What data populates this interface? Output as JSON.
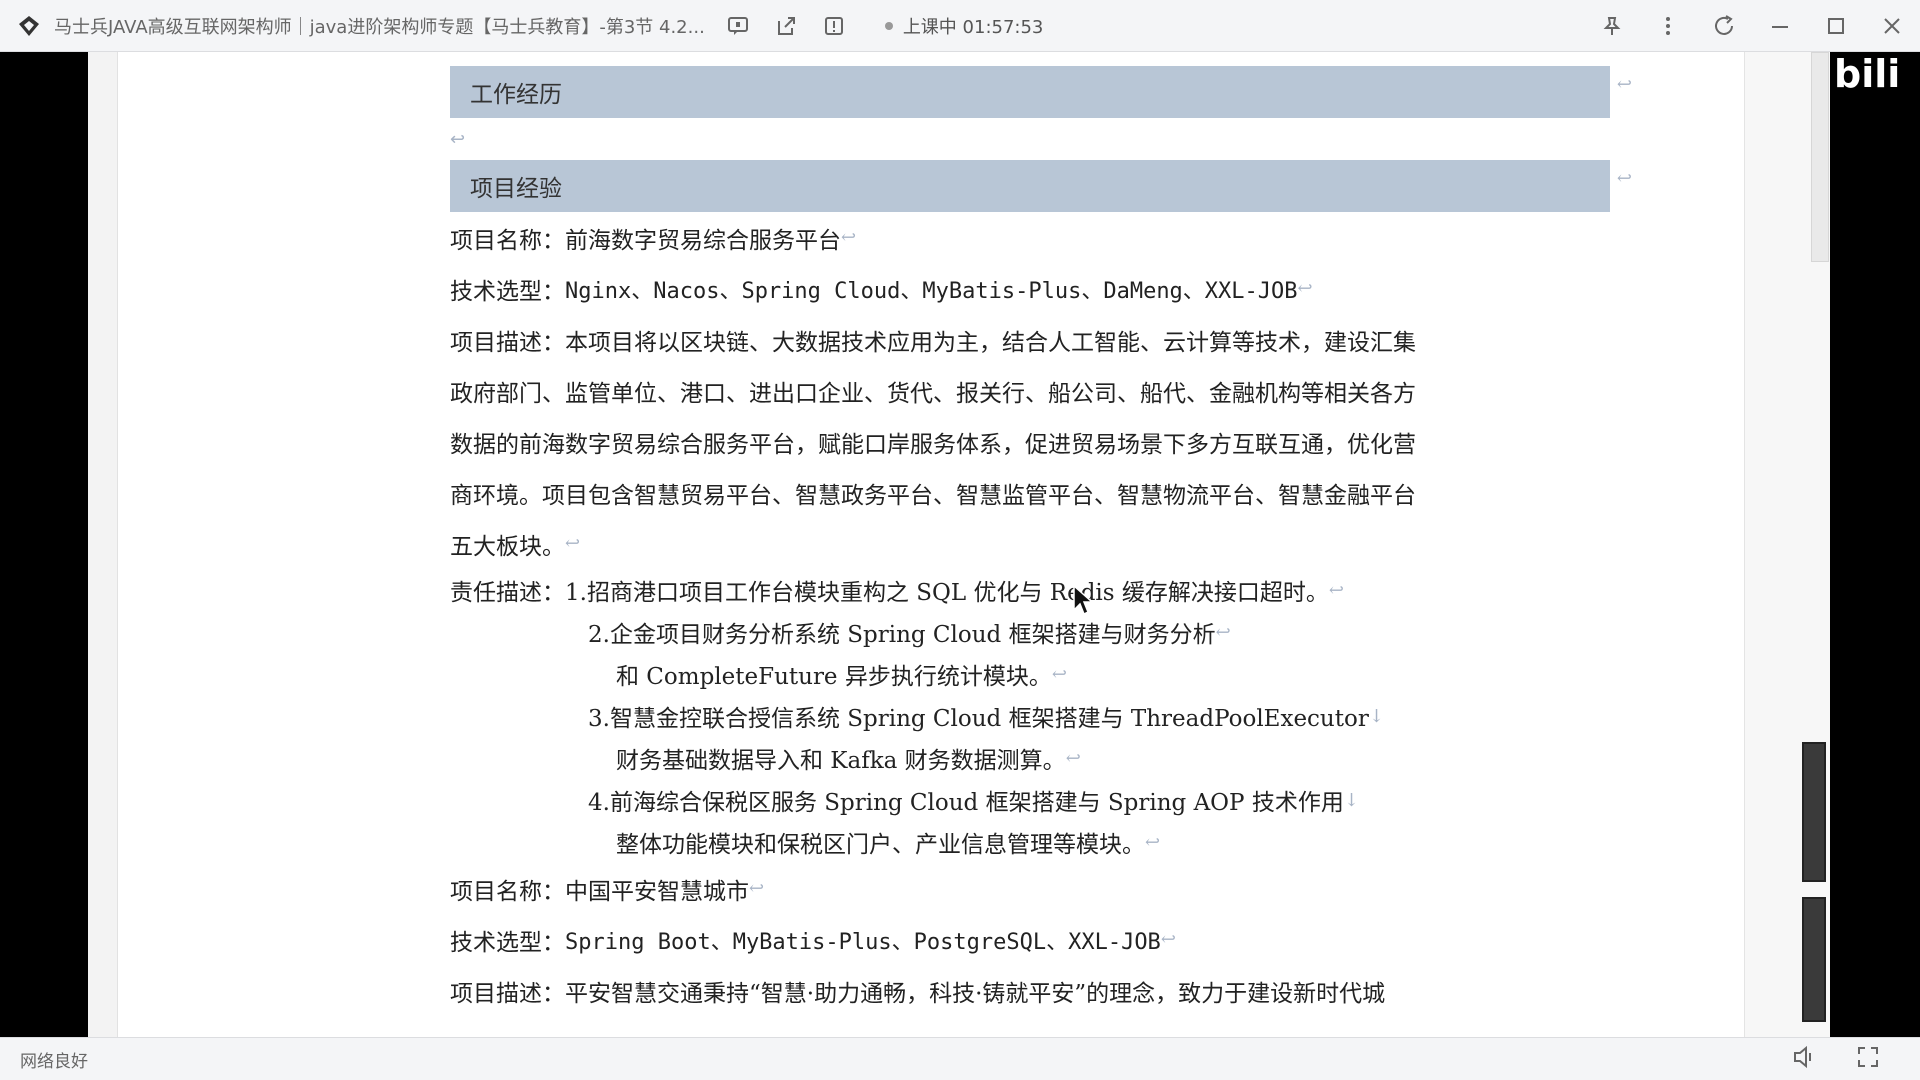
{
  "window": {
    "title": "马士兵JAVA高级互联网架构师｜java进阶架构师专题【马士兵教育】-第3节 4.2...",
    "live_status": "上课中 01:57:53",
    "network_status": "网络良好"
  },
  "watermark": "bili",
  "document": {
    "section_work": "工作经历",
    "section_project": "项目经验",
    "lines": [
      {
        "label": "项目名称：",
        "text": "前海数字贸易综合服务平台"
      },
      {
        "label": "技术选型：",
        "text": "Nginx、Nacos、Spring Cloud、MyBatis-Plus、DaMeng、XXL-JOB"
      },
      {
        "label": "项目描述：",
        "text": "本项目将以区块链、大数据技术应用为主，结合人工智能、云计算等技术，建设汇集"
      },
      {
        "label": "",
        "text": "政府部门、监管单位、港口、进出口企业、货代、报关行、船公司、船代、金融机构等相关各方"
      },
      {
        "label": "",
        "text": "数据的前海数字贸易综合服务平台，赋能口岸服务体系，促进贸易场景下多方互联互通，优化营"
      },
      {
        "label": "",
        "text": "商环境。项目包含智慧贸易平台、智慧政务平台、智慧监管平台、智慧物流平台、智慧金融平台"
      },
      {
        "label": "",
        "text": "五大板块。"
      }
    ],
    "responsibility_label": "责任描述：",
    "responsibilities": [
      "1.招商港口项目工作台模块重构之 SQL 优化与 Redis 缓存解决接口超时。",
      "2.企金项目财务分析系统 Spring Cloud 框架搭建与财务分析",
      "和 CompleteFuture 异步执行统计模块。",
      "3.智慧金控联合授信系统 Spring Cloud 框架搭建与 ThreadPoolExecutor",
      "财务基础数据导入和 Kafka 财务数据测算。",
      "4.前海综合保税区服务 Spring Cloud 框架搭建与 Spring AOP 技术作用",
      "整体功能模块和保税区门户、产业信息管理等模块。"
    ],
    "lines2": [
      {
        "label": "项目名称：",
        "text": "中国平安智慧城市"
      },
      {
        "label": "技术选型：",
        "text": "Spring Boot、MyBatis-Plus、PostgreSQL、XXL-JOB"
      },
      {
        "label": "项目描述：",
        "text": " 平安智慧交通秉持“智慧·助力通畅，科技·铸就平安”的理念，致力于建设新时代城"
      }
    ]
  }
}
